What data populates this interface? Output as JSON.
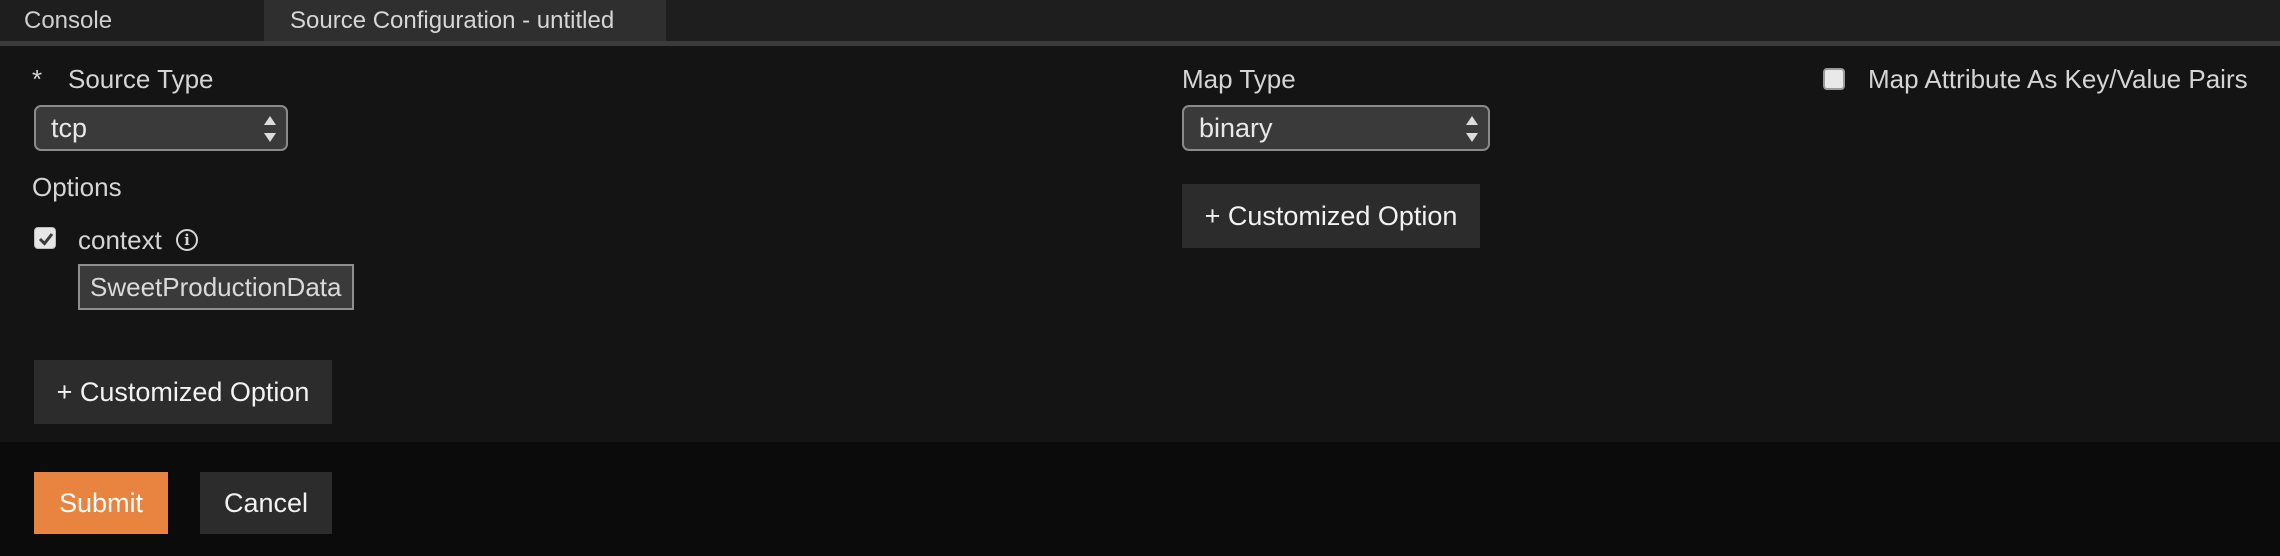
{
  "tabs": [
    {
      "label": "Console"
    },
    {
      "label": "Source Configuration - untitled"
    }
  ],
  "form": {
    "source_type": {
      "required_mark": "*",
      "label": "Source Type",
      "value": "tcp"
    },
    "options": {
      "heading": "Options",
      "context": {
        "label": "context",
        "checked": true,
        "value": "SweetProductionData"
      },
      "add_button": "+ Customized Option"
    },
    "map_type": {
      "label": "Map Type",
      "value": "binary",
      "add_button": "+ Customized Option"
    },
    "map_attribute": {
      "label": "Map Attribute As Key/Value Pairs",
      "checked": false
    }
  },
  "footer": {
    "submit_label": "Submit",
    "cancel_label": "Cancel"
  },
  "colors": {
    "accent": "#e8843f",
    "background": "#141414"
  }
}
